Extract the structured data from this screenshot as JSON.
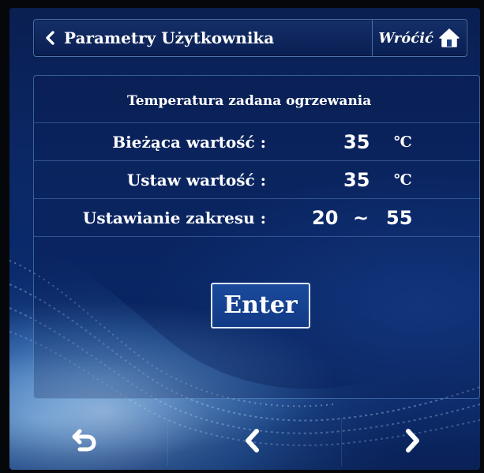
{
  "header": {
    "title": "Parametry Użytkownika",
    "home_label": "Wróćić",
    "back_icon": "chevron-left-icon",
    "home_icon": "home-icon"
  },
  "panel": {
    "title": "Temperatura zadana ogrzewania",
    "rows": [
      {
        "label": "Bieżąca wartość :",
        "value": "35",
        "unit": "℃"
      },
      {
        "label": "Ustaw wartość :",
        "value": "35",
        "unit": "℃"
      },
      {
        "label": "Ustawianie zakresu :",
        "min": "20",
        "separator": "~",
        "max": "55"
      }
    ],
    "enter_label": "Enter"
  },
  "nav": {
    "return_icon": "return-icon",
    "prev_icon": "chevron-left-icon",
    "next_icon": "chevron-right-icon"
  },
  "colors": {
    "background": "#0a2866",
    "text": "#ffffff",
    "border": "#78aae6"
  }
}
